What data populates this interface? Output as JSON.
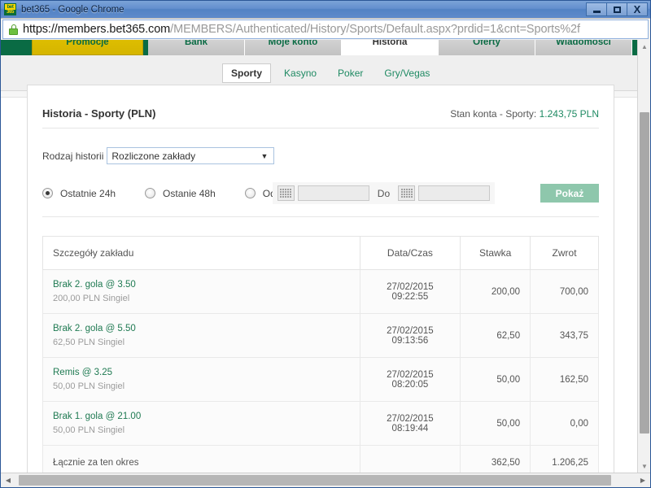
{
  "window": {
    "title": "bet365 - Google Chrome",
    "favicon_top": "bet",
    "favicon_bottom": "365",
    "minimize_label": "Minimize",
    "maximize_label": "Maximize",
    "close_label": "X"
  },
  "address_bar": {
    "lock_icon": "lock-icon",
    "url_host": "https://members.bet365.com",
    "url_path": "/MEMBERS/Authenticated/History/Sports/Default.aspx?prdid=1&cnt=Sports%2f"
  },
  "topnav": {
    "tabs": [
      {
        "label": "Promocje",
        "state": "promo"
      },
      {
        "label": "Bank",
        "state": "grey"
      },
      {
        "label": "Moje konto",
        "state": "grey"
      },
      {
        "label": "Historia",
        "state": "active"
      },
      {
        "label": "Oferty",
        "state": "grey"
      },
      {
        "label": "Wiadomosci",
        "state": "grey"
      }
    ]
  },
  "subnav": {
    "tabs": [
      {
        "label": "Sporty",
        "active": true
      },
      {
        "label": "Kasyno",
        "active": false
      },
      {
        "label": "Poker",
        "active": false
      },
      {
        "label": "Gry/Vegas",
        "active": false
      }
    ]
  },
  "page": {
    "title": "Historia - Sporty (PLN)",
    "balance_label": "Stan konta - Sporty:",
    "balance_amount": "1.243,75 PLN",
    "history_type_label": "Rodzaj historii",
    "history_type_value": "Rozliczone zakłady",
    "dropdown_arrow": "▼"
  },
  "filters": {
    "last24_label": "Ostatnie 24h",
    "last24_checked": true,
    "last48_label": "Ostanie 48h",
    "last48_checked": false,
    "range_label": "Od",
    "range_checked": false,
    "to_label": "Do",
    "date_from_value": "",
    "date_to_value": "",
    "calendar_icon": "calendar-icon",
    "submit_label": "Pokaż"
  },
  "table": {
    "headers": {
      "details": "Szczegóły zakładu",
      "datetime": "Data/Czas",
      "stake": "Stawka",
      "return": "Zwrot"
    },
    "rows": [
      {
        "title": "Brak 2. gola @  3.50",
        "sub": "200,00 PLN  Singiel",
        "datetime": "27/02/2015 09:22:55",
        "stake": "200,00",
        "return": "700,00"
      },
      {
        "title": "Brak 2. gola @  5.50",
        "sub": "62,50 PLN  Singiel",
        "datetime": "27/02/2015 09:13:56",
        "stake": "62,50",
        "return": "343,75"
      },
      {
        "title": "Remis @  3.25",
        "sub": "50,00 PLN  Singiel",
        "datetime": "27/02/2015 08:20:05",
        "stake": "50,00",
        "return": "162,50"
      },
      {
        "title": "Brak 1. gola @  21.00",
        "sub": "50,00 PLN  Singiel",
        "datetime": "27/02/2015 08:19:44",
        "stake": "50,00",
        "return": "0,00"
      }
    ],
    "total": {
      "label": "Łącznie za ten okres",
      "stake": "362,50",
      "return": "1.206,25"
    }
  },
  "scrollbars": {
    "up_arrow": "▲",
    "down_arrow": "▼",
    "left_arrow": "◀",
    "right_arrow": "▶"
  },
  "colors": {
    "brand_green": "#0a6b44",
    "link_green": "#1f8a63",
    "bet_green": "#1f7a52",
    "button_green": "#8ec7ac",
    "promo_yellow": "#d5b500",
    "titlebar_blue": "#5584c4"
  }
}
